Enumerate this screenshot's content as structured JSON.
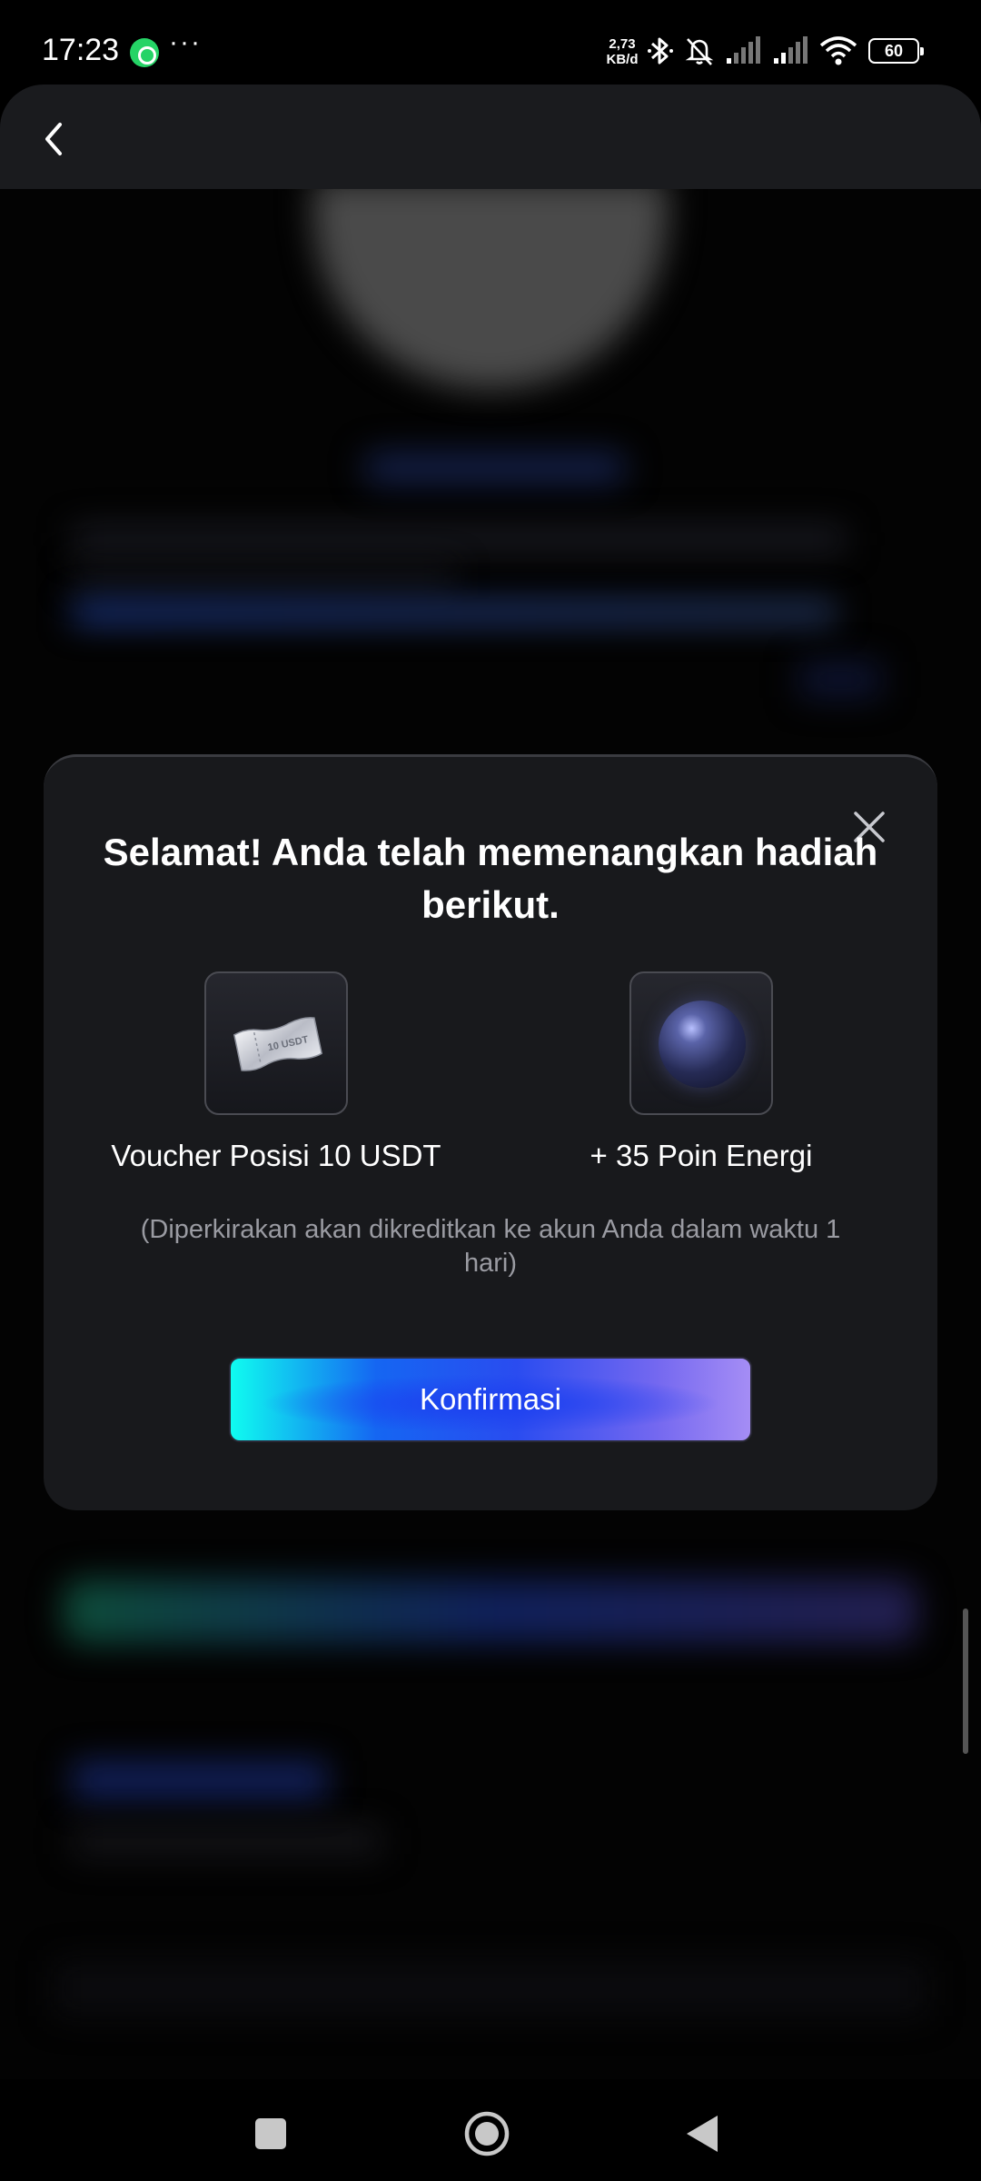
{
  "status_bar": {
    "time": "17:23",
    "net_speed_value": "2,73",
    "net_speed_unit": "KB/d",
    "more_glyph": "···",
    "battery": "60",
    "icons": [
      "whatsapp-icon",
      "bluetooth-icon",
      "mute-bell-icon",
      "signal-icon",
      "signal-icon",
      "wifi-icon",
      "battery-icon"
    ]
  },
  "header": {
    "back_icon": "chevron-left-icon"
  },
  "modal": {
    "title": "Selamat! Anda telah memenangkan hadiah berikut.",
    "close_icon": "close-icon",
    "rewards": [
      {
        "icon": "ticket-icon",
        "ticket_text": "10 USDT",
        "label": "Voucher Posisi 10 USDT"
      },
      {
        "icon": "energy-orb-icon",
        "label": "+ 35 Poin Energi"
      }
    ],
    "note": "(Diperkirakan akan dikreditkan ke akun Anda dalam waktu 1 hari)",
    "confirm_label": "Konfirmasi"
  },
  "nav_bar": {
    "icons": [
      "recents-icon",
      "home-icon",
      "back-icon"
    ]
  },
  "colors": {
    "background": "#000000",
    "modal_bg": "#18191c",
    "button_gradient_start": "#0ffcf0",
    "button_gradient_mid": "#1c3ff0",
    "button_gradient_end": "#a58df5"
  }
}
